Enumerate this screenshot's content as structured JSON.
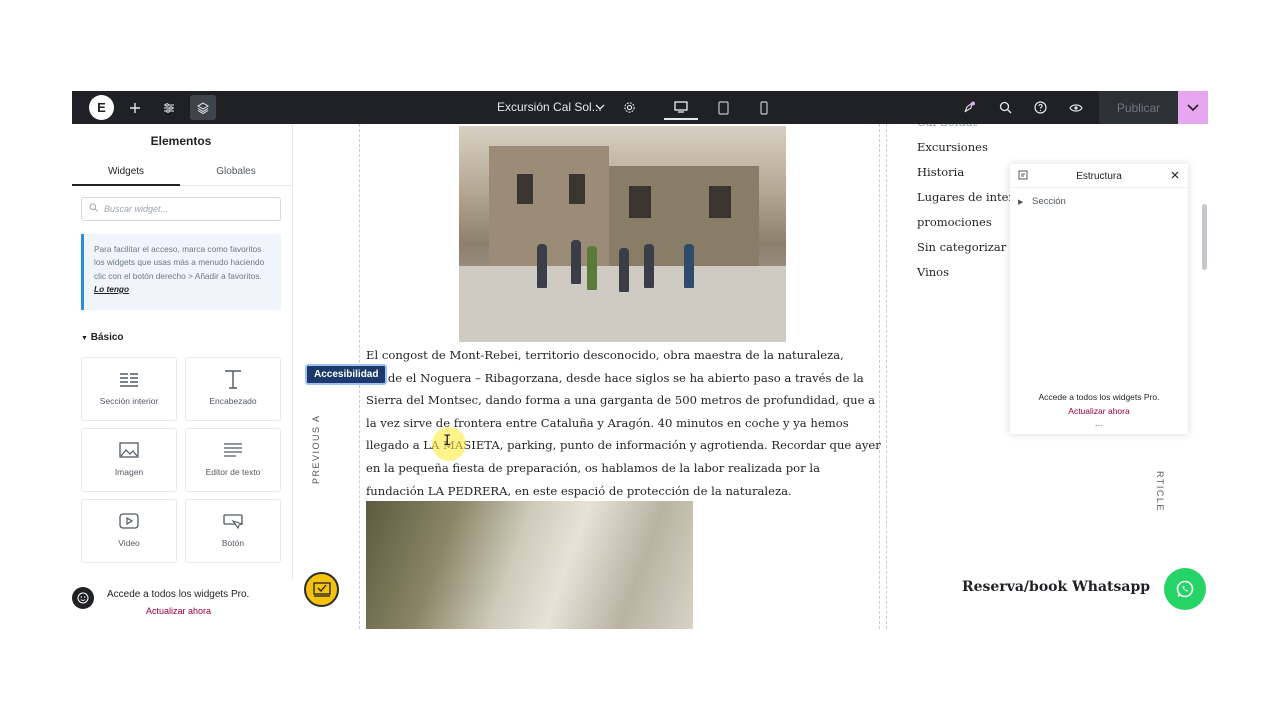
{
  "topbar": {
    "logo": "E",
    "document_title": "Excursión Cal Sol...",
    "publish_label": "Publicar"
  },
  "panel": {
    "title": "Elementos",
    "tabs": [
      "Widgets",
      "Globales"
    ],
    "search_placeholder": "Buscar widget...",
    "tip_text": "Para facilitar el acceso, marca como favoritos los widgets que usas más a menudo haciendo clic con el botón derecho > Añadir a favoritos.",
    "tip_link": "Lo tengo",
    "section": "Básico",
    "widgets": [
      "Sección interior",
      "Encabezado",
      "Imagen",
      "Editor de texto",
      "Video",
      "Botón"
    ],
    "promo_text": "Accede a todos los widgets Pro.",
    "promo_link": "Actualizar ahora"
  },
  "canvas": {
    "prev_label": "PREVIOUS A",
    "next_label": "RTICLE",
    "accessibility_label": "Accesibilidad",
    "article_text": "El congost de Mont-Rebei, territorio desconocido, obra maestra de la naturaleza, donde el Noguera – Ribagorzana, desde hace siglos se ha abierto paso a través de la Sierra del Montsec, dando forma a una garganta de 500 metros de profundidad, que a la vez sirve de frontera entre Cataluña y Aragón. 40 minutos en coche y ya hemos llegado a LA MASIETA, parking, punto de información y agrotienda. Recordar que ayer en la pequeña fiesta de preparación, os hablamos de la labor realizada por la fundación LA PEDRERA, en este espació de protección de la naturaleza.",
    "sidebar_links": [
      "Cal Soldat",
      "Excursiones",
      "Historia",
      "Lugares de interés",
      "promociones",
      "Sin categorizar",
      "Vinos"
    ],
    "whatsapp_text": "Reserva/book Whatsapp"
  },
  "structure": {
    "title": "Estructura",
    "row": "Sección",
    "promo_text": "Accede a todos los widgets Pro.",
    "promo_link": "Actualizar ahora"
  },
  "colors": {
    "topbar": "#1f2124",
    "accent_pink": "#e7a6f0",
    "link_red": "#93003f",
    "whatsapp": "#25d366"
  }
}
